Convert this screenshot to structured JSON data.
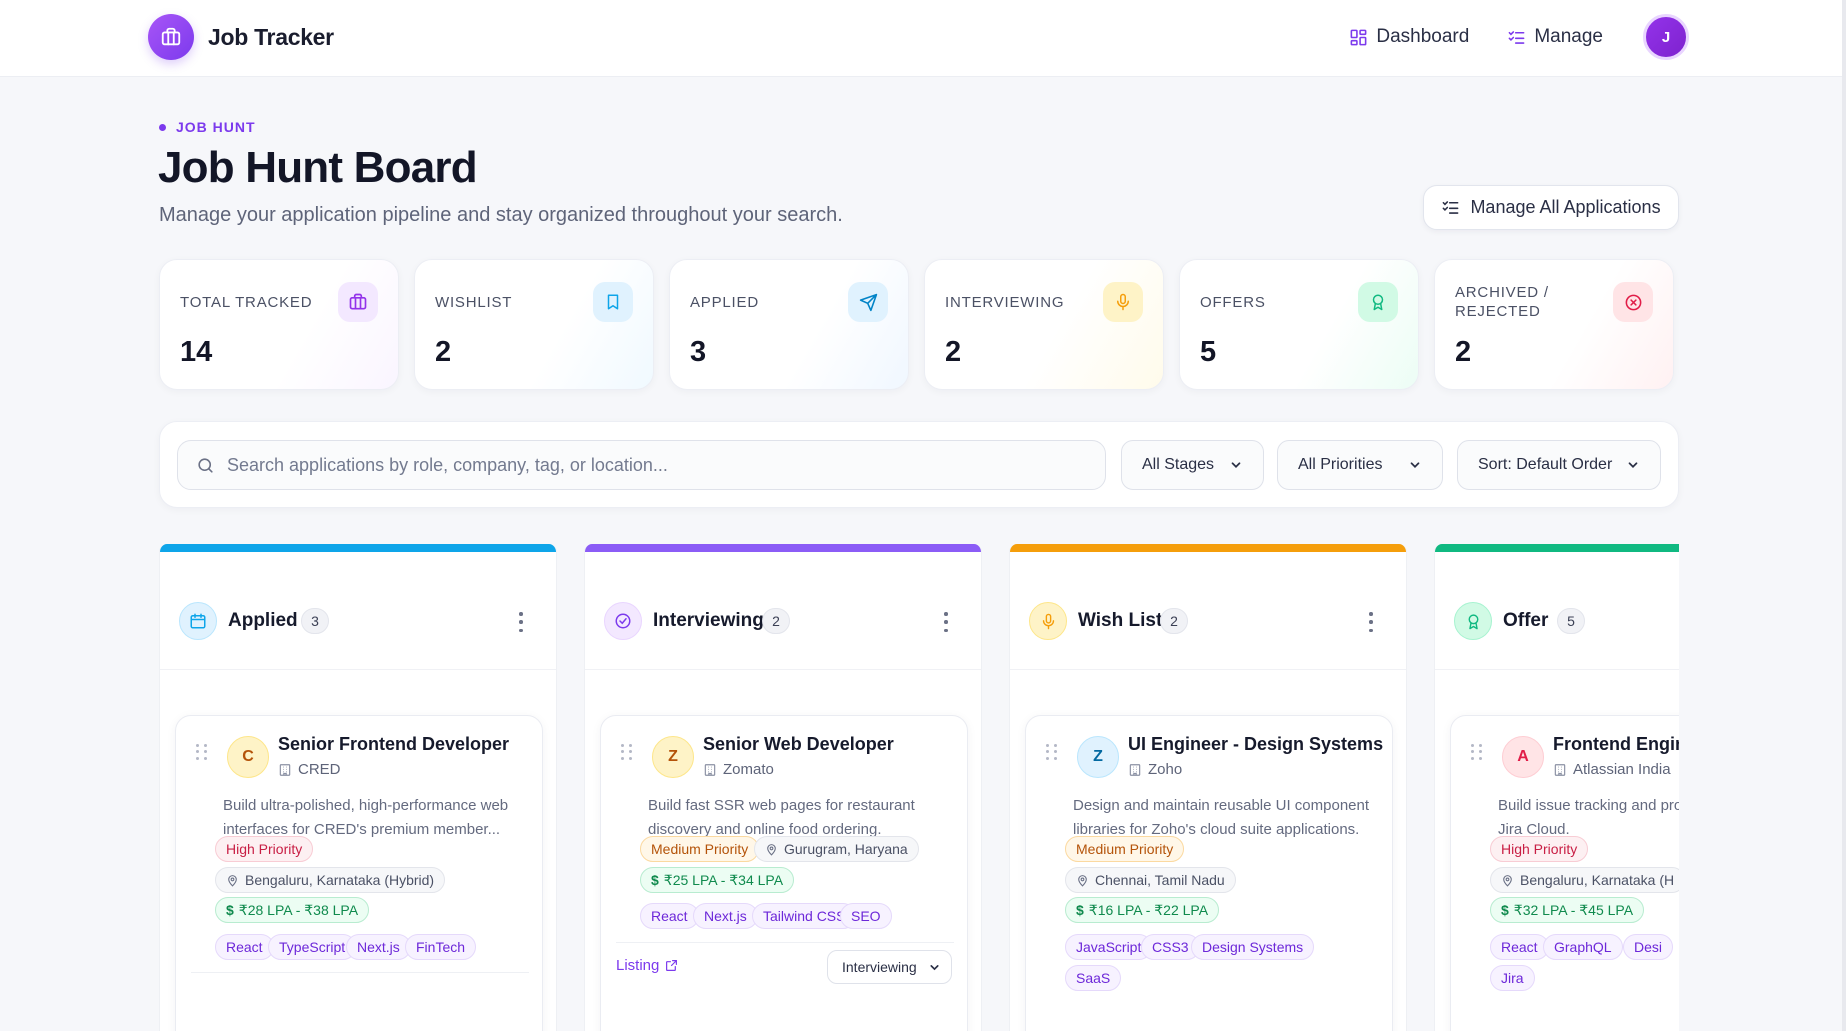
{
  "nav": {
    "brand": "Job Tracker",
    "links": [
      {
        "label": "Dashboard",
        "icon": "grid-icon"
      },
      {
        "label": "Manage",
        "icon": "checklist-icon"
      }
    ],
    "avatar_initial": "J"
  },
  "header": {
    "eyebrow": "JOB HUNT",
    "title": "Job Hunt Board",
    "subtitle": "Manage your application pipeline and stay organized throughout your search.",
    "manage_all_label": "Manage All Applications"
  },
  "stats": [
    {
      "label": "TOTAL TRACKED",
      "value": "14",
      "icon": "briefcase-icon",
      "color": "#9333ea"
    },
    {
      "label": "WISHLIST",
      "value": "2",
      "icon": "bookmark-icon",
      "color": "#0ea5e9"
    },
    {
      "label": "APPLIED",
      "value": "3",
      "icon": "send-icon",
      "color": "#0284c7"
    },
    {
      "label": "INTERVIEWING",
      "value": "2",
      "icon": "microphone-icon",
      "color": "#f59e0b"
    },
    {
      "label": "OFFERS",
      "value": "5",
      "icon": "award-icon",
      "color": "#10b981"
    },
    {
      "label": "ARCHIVED / REJECTED",
      "value": "2",
      "icon": "x-circle-icon",
      "color": "#e11d48"
    }
  ],
  "filters": {
    "search_placeholder": "Search applications by role, company, tag, or location...",
    "stage": "All Stages",
    "priority": "All Priorities",
    "sort": "Sort: Default Order"
  },
  "columns": [
    {
      "title": "Applied",
      "count": "3",
      "color": "#0ea5e9",
      "icon": "calendar-icon",
      "card": {
        "initial": "C",
        "role": "Senior Frontend Developer",
        "company": "CRED",
        "description": "Build ultra-polished, high-performance web interfaces for CRED's premium member...",
        "priority": "High Priority",
        "location": "Bengaluru, Karnataka (Hybrid)",
        "salary": "₹28 LPA - ₹38 LPA",
        "tags": [
          "React",
          "TypeScript",
          "Next.js",
          "FinTech"
        ]
      }
    },
    {
      "title": "Interviewing",
      "count": "2",
      "color": "#8b5cf6",
      "icon": "check-circle-icon",
      "card": {
        "initial": "Z",
        "role": "Senior Web Developer",
        "company": "Zomato",
        "description": "Build fast SSR web pages for restaurant discovery and online food ordering.",
        "priority": "Medium Priority",
        "location": "Gurugram, Haryana",
        "salary": "₹25 LPA - ₹34 LPA",
        "tags": [
          "React",
          "Next.js",
          "Tailwind CSS",
          "SEO"
        ],
        "listing_label": "Listing",
        "stage": "Interviewing"
      }
    },
    {
      "title": "Wish List",
      "count": "2",
      "color": "#f59e0b",
      "icon": "microphone-icon",
      "card": {
        "initial": "Z",
        "role": "UI Engineer - Design Systems",
        "company": "Zoho",
        "description": "Design and maintain reusable UI component libraries for Zoho's cloud suite applications.",
        "priority": "Medium Priority",
        "location": "Chennai, Tamil Nadu",
        "salary": "₹16 LPA - ₹22 LPA",
        "tags": [
          "JavaScript",
          "CSS3",
          "Design Systems",
          "SaaS"
        ]
      }
    },
    {
      "title": "Offer",
      "count": "5",
      "color": "#10b981",
      "icon": "award-icon",
      "card": {
        "initial": "A",
        "role": "Frontend Engin",
        "company": "Atlassian India",
        "description": "Build issue tracking and pro interfaces for Jira Cloud.",
        "priority": "High Priority",
        "location": "Bengaluru, Karnataka (H",
        "salary": "₹32 LPA - ₹45 LPA",
        "tags": [
          "React",
          "GraphQL",
          "Desi",
          "Jira"
        ]
      }
    }
  ]
}
